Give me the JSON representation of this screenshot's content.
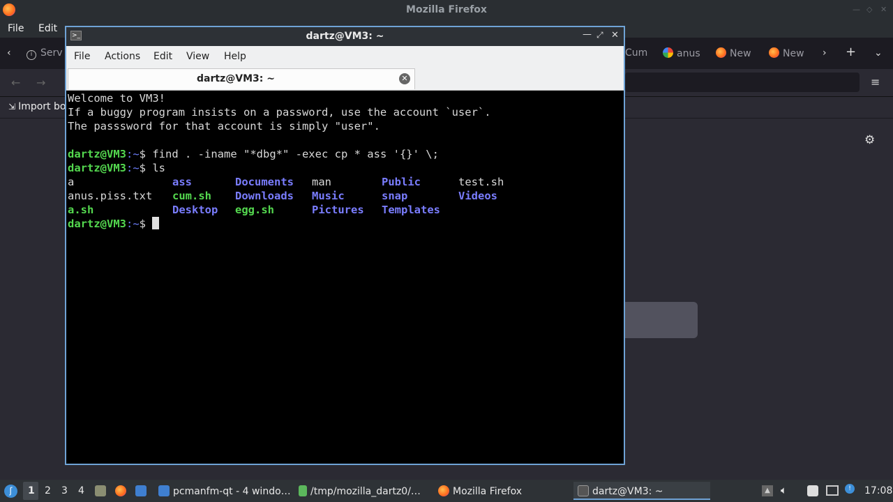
{
  "firefox": {
    "title": "Mozilla Firefox",
    "menu": [
      "File",
      "Edit"
    ],
    "tabs": [
      "Serv",
      "Cum",
      "anus",
      "New",
      "New"
    ],
    "bookmarks_label": "Import bo"
  },
  "terminal": {
    "title": "dartz@VM3: ~",
    "menu": [
      "File",
      "Actions",
      "Edit",
      "View",
      "Help"
    ],
    "tab_label": "dartz@VM3: ~",
    "motd": [
      "Welcome to VM3!",
      "If a buggy program insists on a password, use the account `user`.",
      "The passsword for that account is simply \"user\"."
    ],
    "prompt_user": "dartz@VM3",
    "prompt_path": ":~",
    "prompt_sym": "$ ",
    "cmd1": "find . -iname \"*dbg*\" -exec cp * ass '{}' \\;",
    "cmd2": "ls",
    "ls": [
      [
        "a",
        "ass",
        "Documents",
        "man",
        "Public",
        "test.sh"
      ],
      [
        "anus.piss.txt",
        "cum.sh",
        "Downloads",
        "Music",
        "snap",
        "Videos"
      ],
      [
        "a.sh",
        "Desktop",
        "egg.sh",
        "Pictures",
        "Templates",
        ""
      ]
    ]
  },
  "taskbar": {
    "desktops": [
      "1",
      "2",
      "3",
      "4"
    ],
    "tasks": [
      "pcmanfm-qt - 4 windo…",
      "/tmp/mozilla_dartz0/…",
      "Mozilla Firefox",
      "dartz@VM3: ~"
    ],
    "clock": "17:08"
  },
  "colors": {
    "accent": "#6fa3d6",
    "prompt": "#54d84f",
    "dir": "#7a7dff"
  }
}
